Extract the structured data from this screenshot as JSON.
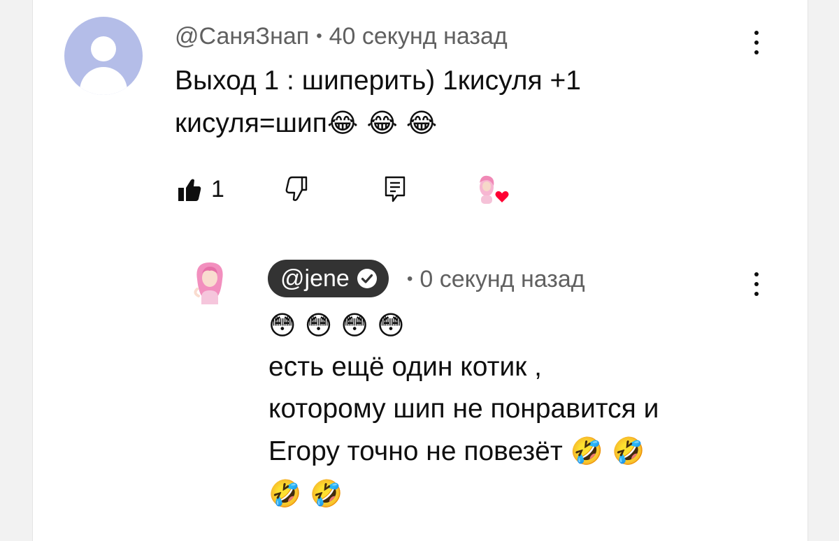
{
  "comment": {
    "author": "@СаняЗнап",
    "separator": "•",
    "time": "40 секунд назад",
    "text_lines": [
      "Выход 1 : шиперить) 1кисуля +1",
      "кисуля=шип"
    ],
    "text_emoji": "😂 😂 😂",
    "like_count": "1",
    "hearted_by_creator": true,
    "icons": {
      "avatar": "default-user-avatar-icon",
      "like": "thumbs-up-filled-icon",
      "dislike": "thumbs-down-icon",
      "reply": "reply-comment-icon",
      "heart": "creator-heart-icon",
      "menu": "more-vertical-icon"
    }
  },
  "reply": {
    "author": "@jene",
    "verified": true,
    "separator": "•",
    "time": "0 секунд назад",
    "emoji_line": "😳 😳 😳 😳",
    "text_lines": [
      "есть ещё один котик ,",
      "которому шип не понравится и",
      "Егору точно не повезёт"
    ],
    "trailing_emoji_1": "🤣 🤣",
    "trailing_emoji_2": "🤣 🤣",
    "icons": {
      "avatar": "creator-avatar-icon",
      "verified": "verified-check-icon",
      "menu": "more-vertical-icon"
    }
  },
  "colors": {
    "background": "#ffffff",
    "meta_text": "#606060",
    "chip_background": "#333333",
    "avatar_default": "#b4bde8",
    "heart": "#ff0033"
  }
}
